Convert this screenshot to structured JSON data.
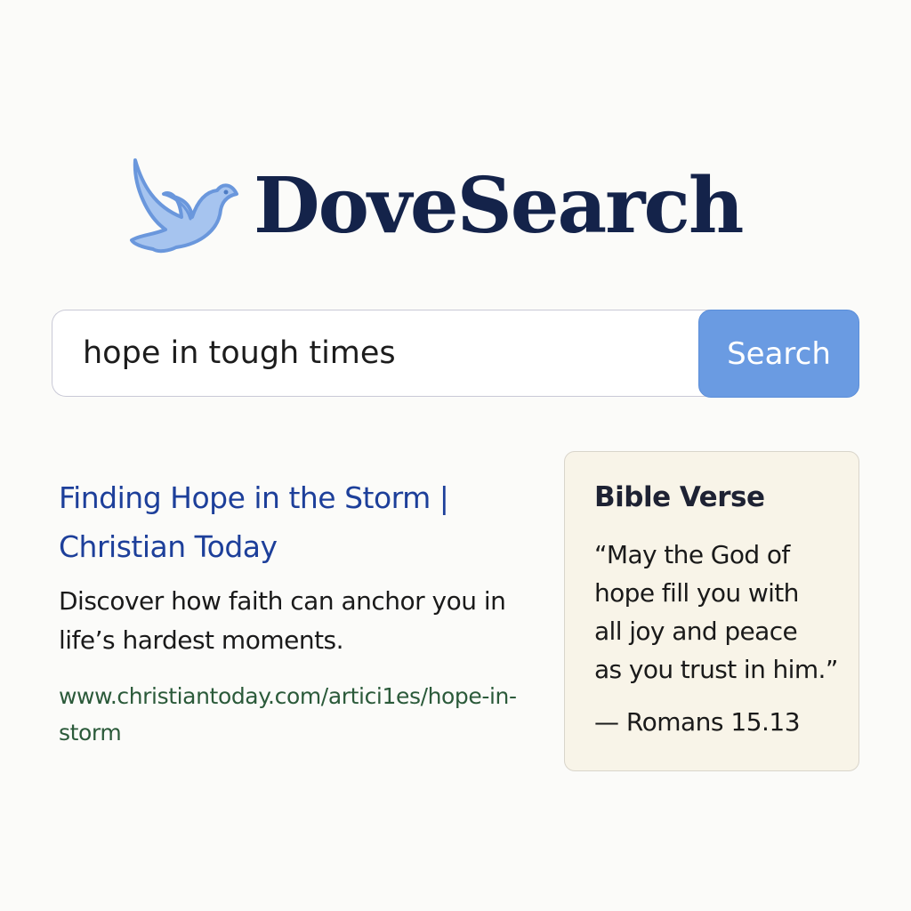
{
  "header": {
    "logo_text": "DoveSearch",
    "logo_icon": "dove-icon",
    "colors": {
      "logo_text": "#14234a",
      "dove_fill": "#a6c4ef",
      "dove_outline": "#6a97dc"
    }
  },
  "search": {
    "query": "hope in tough times",
    "button_label": "Search",
    "button_color": "#6a9be2"
  },
  "results": [
    {
      "title": "Finding Hope in the Storm | Christian Today",
      "snippet": "Discover how faith can anchor you in life’s hardest moments.",
      "url": "www.christiantoday.com/artici1es/hope-in-storm",
      "title_color": "#1d3f9a",
      "url_color": "#2b5a3a"
    }
  ],
  "sidebar_card": {
    "heading": "Bible Verse",
    "verse": "“May the God of\nhope fill you with\nall joy and peace\nas you trust in him.”",
    "reference": "— Romans 15.13",
    "background": "#f8f4e8"
  }
}
